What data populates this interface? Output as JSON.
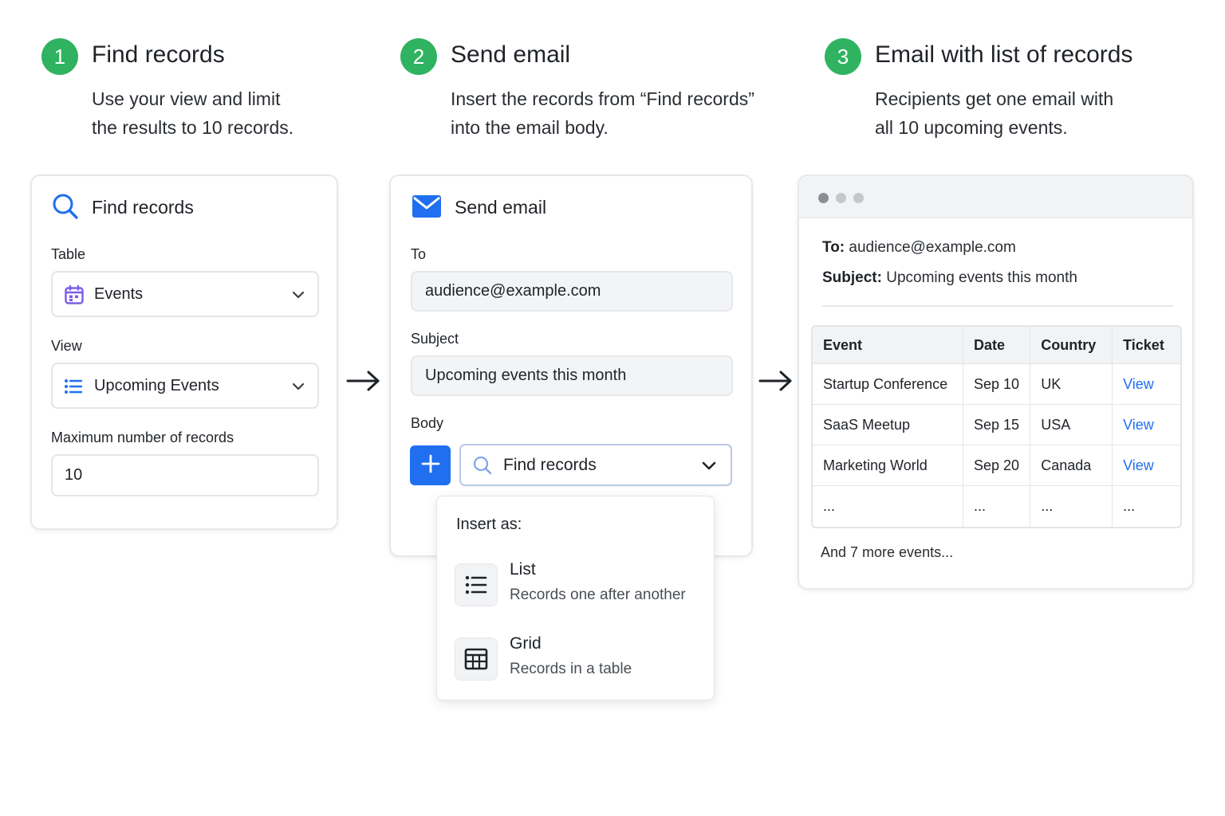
{
  "steps": [
    {
      "number": "1",
      "title": "Find records",
      "desc_line1": "Use your view and limit",
      "desc_line2": "the results to 10 records."
    },
    {
      "number": "2",
      "title": "Send email",
      "desc_line1": "Insert the records from “Find records”",
      "desc_line2": "into the email body."
    },
    {
      "number": "3",
      "title": "Email with list of records",
      "desc_line1": "Recipients get one email with",
      "desc_line2": "all 10 upcoming events."
    }
  ],
  "find_card": {
    "title": "Find records",
    "table_label": "Table",
    "table_value": "Events",
    "view_label": "View",
    "view_value": "Upcoming Events",
    "max_label": "Maximum number of records",
    "max_value": "10"
  },
  "send_card": {
    "title": "Send email",
    "to_label": "To",
    "to_value": "audience@example.com",
    "subject_label": "Subject",
    "subject_value": "Upcoming events this month",
    "body_label": "Body",
    "body_select_value": "Find records"
  },
  "insert_menu": {
    "heading": "Insert as:",
    "items": [
      {
        "title": "List",
        "subtitle": "Records one after another",
        "icon": "list-icon"
      },
      {
        "title": "Grid",
        "subtitle": "Records in a table",
        "icon": "grid-icon"
      }
    ]
  },
  "email_preview": {
    "to_label": "To:",
    "to_value": "audience@example.com",
    "subject_label": "Subject:",
    "subject_value": "Upcoming events this month",
    "columns": [
      "Event",
      "Date",
      "Country",
      "Ticket"
    ],
    "rows": [
      [
        "Startup Conference",
        "Sep 10",
        "UK",
        "View"
      ],
      [
        "SaaS Meetup",
        "Sep 15",
        "USA",
        "View"
      ],
      [
        "Marketing World",
        "Sep 20",
        "Canada",
        "View"
      ],
      [
        "...",
        "...",
        "...",
        "..."
      ]
    ],
    "more_text": "And 7 more events..."
  },
  "colors": {
    "accent": "#1f6ff0",
    "step_badge": "#2fb360",
    "calendar_icon": "#7b5ce6",
    "window_dots": [
      "#8a8f96",
      "#c4c7cc",
      "#c4c7cc"
    ]
  }
}
